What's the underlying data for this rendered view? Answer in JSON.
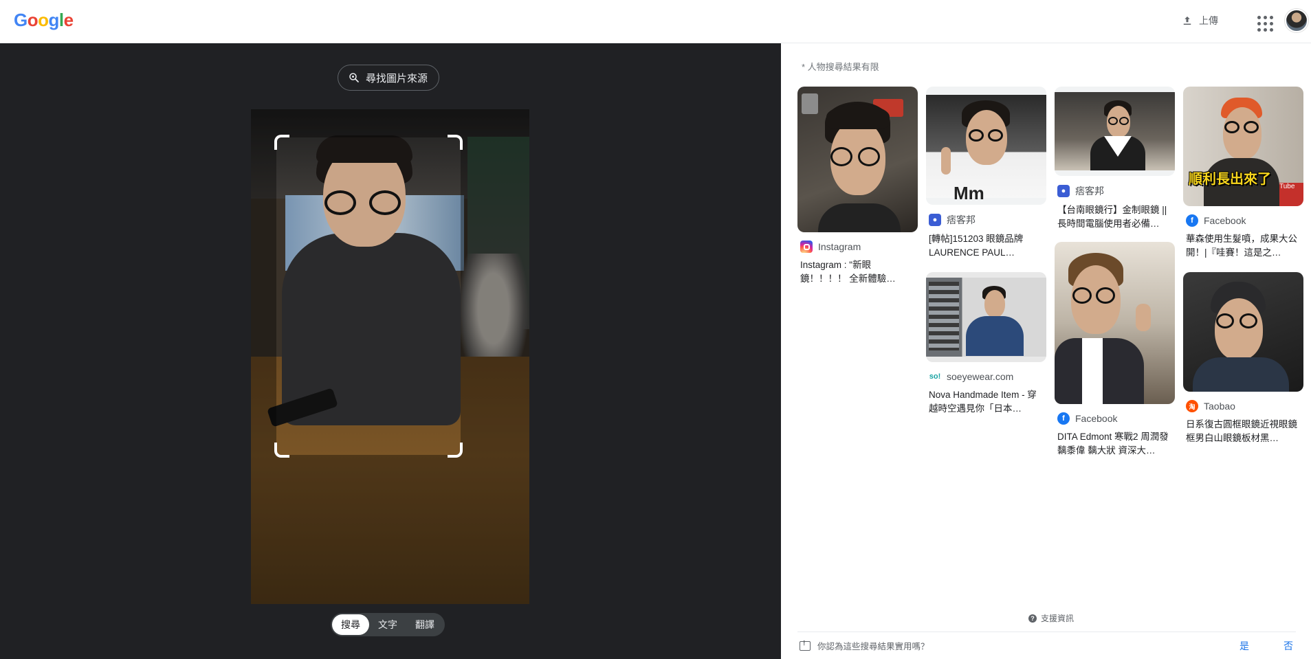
{
  "header": {
    "logo": {
      "letters": [
        "G",
        "o",
        "o",
        "g",
        "l",
        "e"
      ],
      "colors": [
        "#4285F4",
        "#EA4335",
        "#FBBC05",
        "#4285F4",
        "#34A853",
        "#EA4335"
      ]
    },
    "upload_label": "上傳"
  },
  "viewer": {
    "find_source_label": "尋找圖片來源",
    "tabs": [
      {
        "label": "搜尋",
        "active": true
      },
      {
        "label": "文字",
        "active": false
      },
      {
        "label": "翻譯",
        "active": false
      }
    ]
  },
  "results": {
    "notice": "* 人物搜尋結果有限",
    "columns": [
      [
        {
          "source": "Instagram",
          "source_icon": "instagram-icon",
          "icon_color": "#d6249f",
          "title": "Instagram : \"新眼鏡！！！！ 全新體驗…"
        }
      ],
      [
        {
          "source": "痞客邦",
          "source_icon": "pixnet-icon",
          "icon_color": "#3b5dd4",
          "title": "[轉帖]151203 眼鏡品牌 LAURENCE PAUL…"
        },
        {
          "source": "soeyewear.com",
          "source_icon": "soeyewear-icon",
          "icon_color": "#1aa3a3",
          "title": "Nova Handmade Item - 穿越時空遇見你「日本…"
        }
      ],
      [
        {
          "source": "痞客邦",
          "source_icon": "pixnet-icon",
          "icon_color": "#3b5dd4",
          "title": "【台南眼鏡行】金制眼鏡 || 長時間電腦使用者必備…"
        },
        {
          "source": "Facebook",
          "source_icon": "facebook-icon",
          "icon_color": "#1877f2",
          "title": "DITA Edmont 寒戰2 周潤發 黐黍偉 黐大狀 資深大…"
        }
      ],
      [
        {
          "source": "Facebook",
          "source_icon": "facebook-icon",
          "icon_color": "#1877f2",
          "title": "華森使用生髮噴，成果大公開！|『哇賽！這是之…",
          "overlay": "順利長出來了"
        },
        {
          "source": "Taobao",
          "source_icon": "taobao-icon",
          "icon_color": "#ff5000",
          "title": "日系復古圓框眼鏡近視眼鏡框男白山眼鏡板材黑…"
        }
      ]
    ],
    "support_label": "支援資訊",
    "feedback_question": "你認為這些搜尋結果實用嗎？",
    "yes_label": "是",
    "no_label": "否"
  }
}
